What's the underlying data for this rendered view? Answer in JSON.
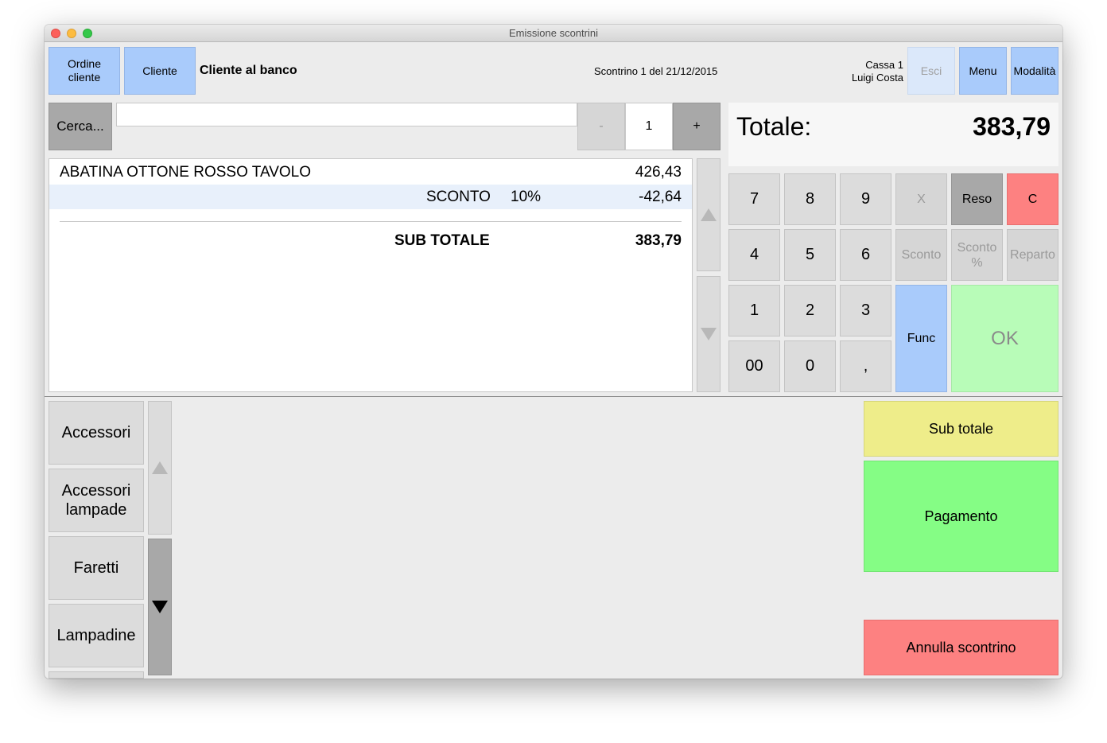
{
  "window": {
    "title": "Emissione scontrini"
  },
  "header": {
    "ordine_cliente": "Ordine\ncliente",
    "cliente": "Cliente",
    "customer_name": "Cliente al banco",
    "receipt_info": "Scontrino 1 del 21/12/2015",
    "register": "Cassa 1",
    "operator": "Luigi Costa",
    "esci": "Esci",
    "menu": "Menu",
    "modalita": "Modalità"
  },
  "search": {
    "button": "Cerca...",
    "value": "",
    "minus": "-",
    "qty": "1",
    "plus": "+"
  },
  "receipt": {
    "item_name": "ABATINA OTTONE ROSSO TAVOLO",
    "item_price": "426,43",
    "discount_label": "SCONTO",
    "discount_pct": "10%",
    "discount_amount": "-42,64",
    "subtotal_label": "SUB TOTALE",
    "subtotal_value": "383,79"
  },
  "total": {
    "label": "Totale:",
    "value": "383,79"
  },
  "keypad": {
    "k7": "7",
    "k8": "8",
    "k9": "9",
    "x": "X",
    "reso": "Reso",
    "c": "C",
    "k4": "4",
    "k5": "5",
    "k6": "6",
    "sconto": "Sconto",
    "sconto_pct": "Sconto\n%",
    "reparto": "Reparto",
    "k1": "1",
    "k2": "2",
    "k3": "3",
    "func": "Func",
    "ok": "OK",
    "k00": "00",
    "k0": "0",
    "comma": ","
  },
  "categories": [
    "Accessori",
    "Accessori\nlampade",
    "Faretti",
    "Lampadine"
  ],
  "actions": {
    "subtotale": "Sub totale",
    "pagamento": "Pagamento",
    "annulla": "Annulla scontrino"
  }
}
